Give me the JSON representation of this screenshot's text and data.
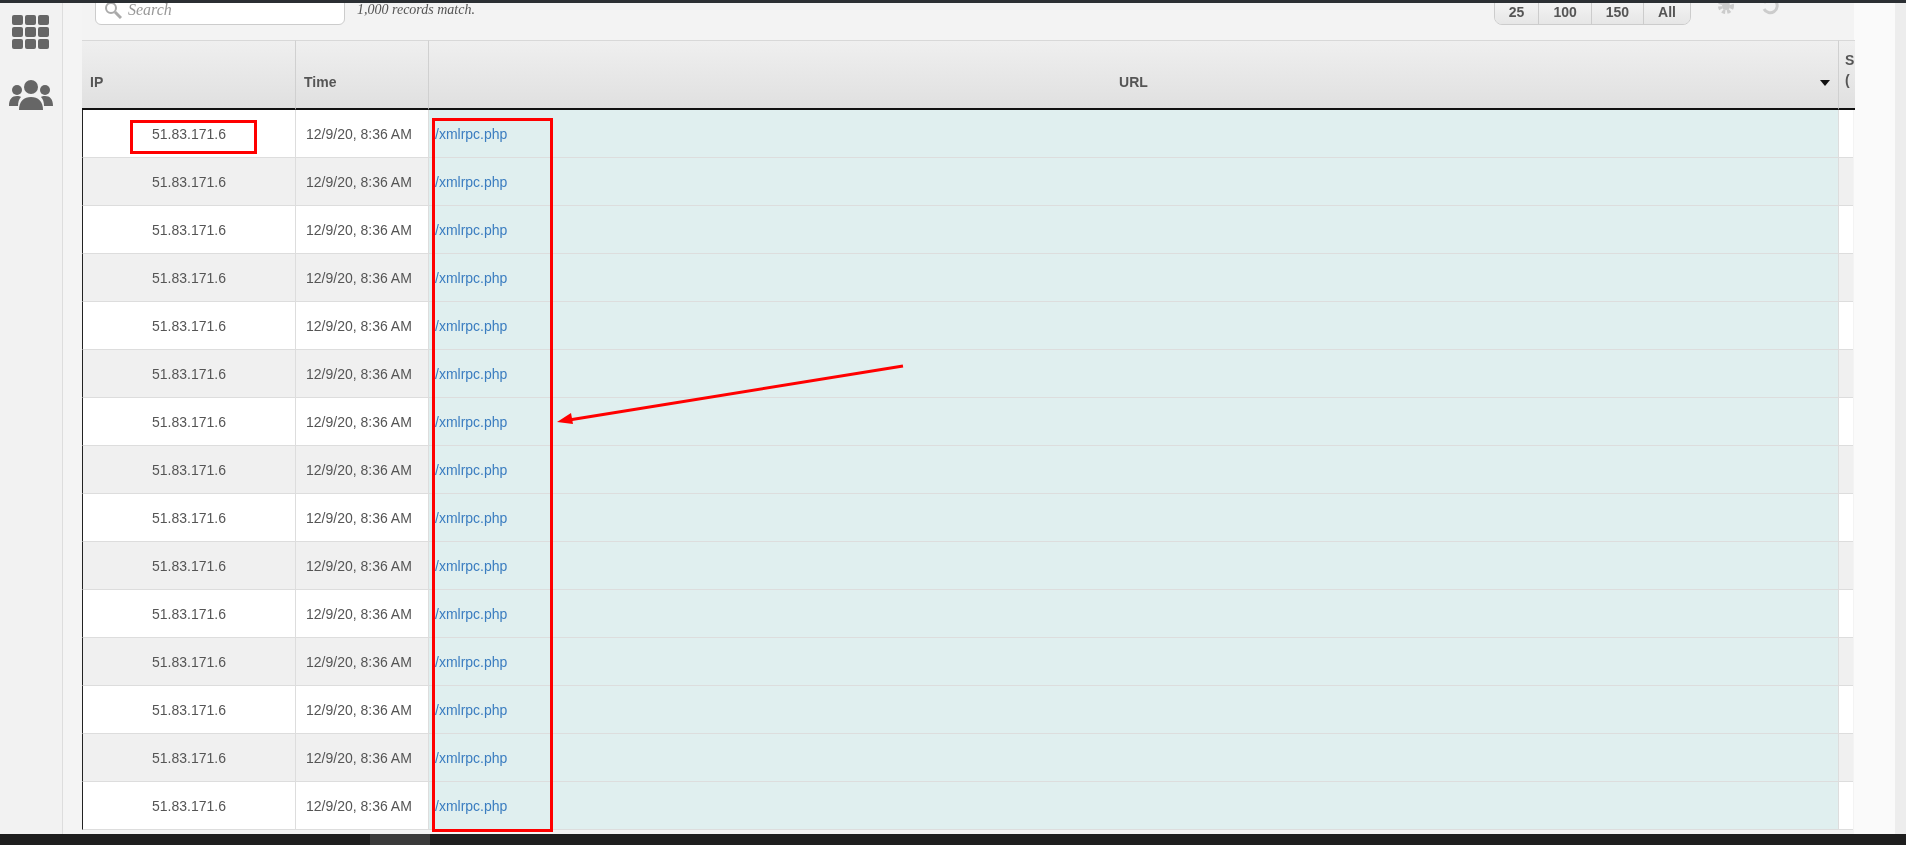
{
  "toolbar": {
    "search": {
      "placeholder": "Search"
    },
    "match_count": "1,000 records match.",
    "page_sizes": [
      {
        "label": "25"
      },
      {
        "label": "100"
      },
      {
        "label": "150"
      },
      {
        "label": "All"
      }
    ]
  },
  "table": {
    "columns": [
      {
        "label": "IP",
        "sorted": false
      },
      {
        "label": "Time",
        "sorted": false
      },
      {
        "label": "URL",
        "sorted": true
      },
      {
        "label": "S (",
        "sorted": false
      }
    ],
    "rows": [
      {
        "ip": "51.83.171.6",
        "time": "12/9/20, 8:36 AM",
        "url": "/xmlrpc.php"
      },
      {
        "ip": "51.83.171.6",
        "time": "12/9/20, 8:36 AM",
        "url": "/xmlrpc.php"
      },
      {
        "ip": "51.83.171.6",
        "time": "12/9/20, 8:36 AM",
        "url": "/xmlrpc.php"
      },
      {
        "ip": "51.83.171.6",
        "time": "12/9/20, 8:36 AM",
        "url": "/xmlrpc.php"
      },
      {
        "ip": "51.83.171.6",
        "time": "12/9/20, 8:36 AM",
        "url": "/xmlrpc.php"
      },
      {
        "ip": "51.83.171.6",
        "time": "12/9/20, 8:36 AM",
        "url": "/xmlrpc.php"
      },
      {
        "ip": "51.83.171.6",
        "time": "12/9/20, 8:36 AM",
        "url": "/xmlrpc.php"
      },
      {
        "ip": "51.83.171.6",
        "time": "12/9/20, 8:36 AM",
        "url": "/xmlrpc.php"
      },
      {
        "ip": "51.83.171.6",
        "time": "12/9/20, 8:36 AM",
        "url": "/xmlrpc.php"
      },
      {
        "ip": "51.83.171.6",
        "time": "12/9/20, 8:36 AM",
        "url": "/xmlrpc.php"
      },
      {
        "ip": "51.83.171.6",
        "time": "12/9/20, 8:36 AM",
        "url": "/xmlrpc.php"
      },
      {
        "ip": "51.83.171.6",
        "time": "12/9/20, 8:36 AM",
        "url": "/xmlrpc.php"
      },
      {
        "ip": "51.83.171.6",
        "time": "12/9/20, 8:36 AM",
        "url": "/xmlrpc.php"
      },
      {
        "ip": "51.83.171.6",
        "time": "12/9/20, 8:36 AM",
        "url": "/xmlrpc.php"
      },
      {
        "ip": "51.83.171.6",
        "time": "12/9/20, 8:36 AM",
        "url": "/xmlrpc.php"
      }
    ]
  },
  "annotations": [
    {
      "kind": "box"
    },
    {
      "kind": "box"
    },
    {
      "kind": "arrow"
    }
  ]
}
